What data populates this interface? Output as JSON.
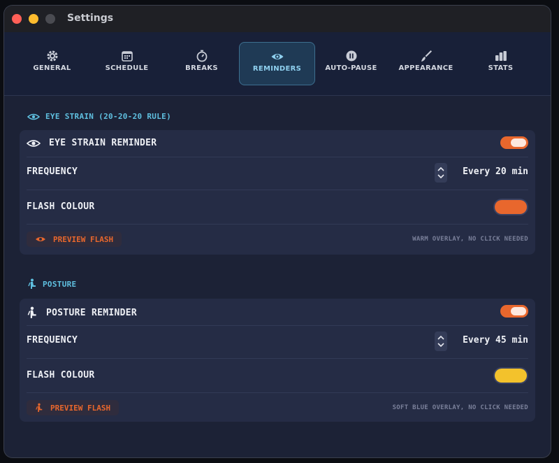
{
  "window": {
    "title": "Settings"
  },
  "tabs": [
    {
      "label": "GENERAL",
      "icon": "gear-icon"
    },
    {
      "label": "SCHEDULE",
      "icon": "calendar-icon"
    },
    {
      "label": "BREAKS",
      "icon": "timer-icon"
    },
    {
      "label": "REMINDERS",
      "icon": "eye-icon",
      "active": true
    },
    {
      "label": "AUTO-PAUSE",
      "icon": "pause-icon"
    },
    {
      "label": "APPEARANCE",
      "icon": "brush-icon"
    },
    {
      "label": "STATS",
      "icon": "bar-chart-icon"
    }
  ],
  "eye_section": {
    "heading": "EYE STRAIN (20-20-20 RULE)",
    "title": "EYE STRAIN REMINDER",
    "enabled": true,
    "frequency_label": "FREQUENCY",
    "frequency_value": "Every 20 min",
    "flash_label": "FLASH COLOUR",
    "flash_color": "#e8672d",
    "preview_label": "PREVIEW FLASH",
    "hint": "WARM OVERLAY, NO CLICK NEEDED"
  },
  "posture_section": {
    "heading": "POSTURE",
    "title": "POSTURE REMINDER",
    "enabled": true,
    "frequency_label": "FREQUENCY",
    "frequency_value": "Every 45 min",
    "flash_label": "FLASH COLOUR",
    "flash_color": "#f3c22c",
    "preview_label": "PREVIEW FLASH",
    "hint": "SOFT BLUE OVERLAY, NO CLICK NEEDED"
  },
  "colors": {
    "accent": "#e8672d",
    "active_tab": "#8fd0ef",
    "section_heading": "#5fc0e0"
  }
}
